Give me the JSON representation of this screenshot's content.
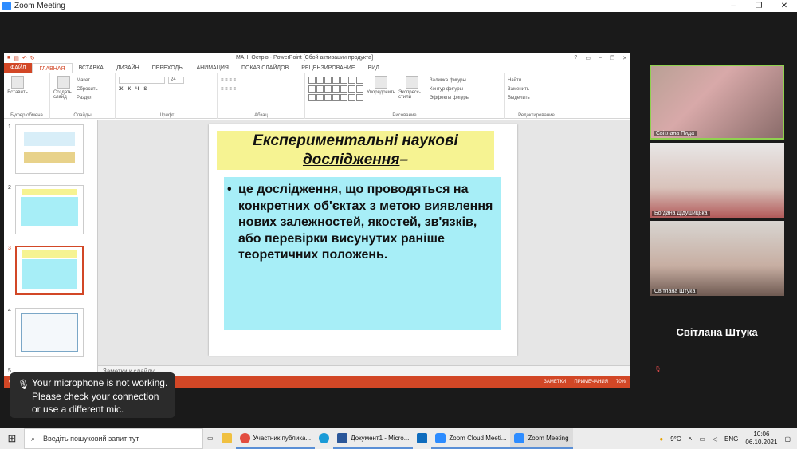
{
  "zoom": {
    "title": "Zoom Meeting",
    "window_controls": [
      "–",
      "❐",
      "✕"
    ]
  },
  "ppt": {
    "window_title": "МАН, Острів - PowerPoint [Сбой активации продукта]",
    "window_controls": [
      "?",
      "▭",
      "–",
      "❐",
      "✕"
    ],
    "tabs": [
      "ФАЙЛ",
      "ГЛАВНАЯ",
      "ВСТАВКА",
      "ДИЗАЙН",
      "ПЕРЕХОДЫ",
      "АНИМАЦИЯ",
      "ПОКАЗ СЛАЙДОВ",
      "РЕЦЕНЗИРОВАНИЕ",
      "ВИД"
    ],
    "ribbon": {
      "paste": "Вставить",
      "new_slide": "Создать слайд",
      "layout": "Макет",
      "reset": "Сбросить",
      "section": "Раздел",
      "font_size": "24",
      "arrange": "Упорядочить",
      "quick_styles": "Экспресс-стили",
      "fill": "Заливка фигуры",
      "outline": "Контур фигуры",
      "effects": "Эффекты фигуры",
      "find": "Найти",
      "replace": "Заменить",
      "select": "Выделить",
      "groups": [
        "Буфер обмена",
        "Слайды",
        "Шрифт",
        "Абзац",
        "Рисование",
        "Редактирование"
      ]
    },
    "slide_numbers": [
      "1",
      "2",
      "3",
      "4",
      "5"
    ],
    "slide": {
      "title_line1": "Експериментальні наукові",
      "title_line2": "дослідження",
      "title_dash": "–",
      "bullet": "•",
      "body": "це дослідження, що проводяться на конкретних об'єктах з метою виявлення нових залежностей, якостей, зв'язків, або перевірки висунутих раніше теоретичних положень."
    },
    "notes_placeholder": "Заметки к слайду",
    "status": {
      "slide_info": "СЛ",
      "notes": "ЗАМЕТКИ",
      "comments": "ПРИМЕЧАНИЯ",
      "zoom": "70%"
    }
  },
  "participants": [
    {
      "name": "Світлана Пида"
    },
    {
      "name": "Богдана Дідушицька"
    },
    {
      "name": "Світлана Штука"
    },
    {
      "name": "Світлана Штука"
    }
  ],
  "toast": {
    "message": "Your microphone is not working. Please check your connection or use a different mic."
  },
  "taskbar": {
    "search_placeholder": "Введіть пошуковий запит тут",
    "items": [
      "Участник публика...",
      "Документ1 - Micro...",
      "Zoom Cloud Meeti...",
      "Zoom Meeting"
    ],
    "weather": "9°C",
    "language": "ENG",
    "time": "10:06",
    "date": "06.10.2021"
  },
  "colors": {
    "ppt_accent": "#D24726",
    "slide_title_bg": "#F6F392",
    "slide_body_bg": "#A7EEF7",
    "active_speaker": "#8FD14F",
    "zoom_blue": "#2D8CFF"
  }
}
